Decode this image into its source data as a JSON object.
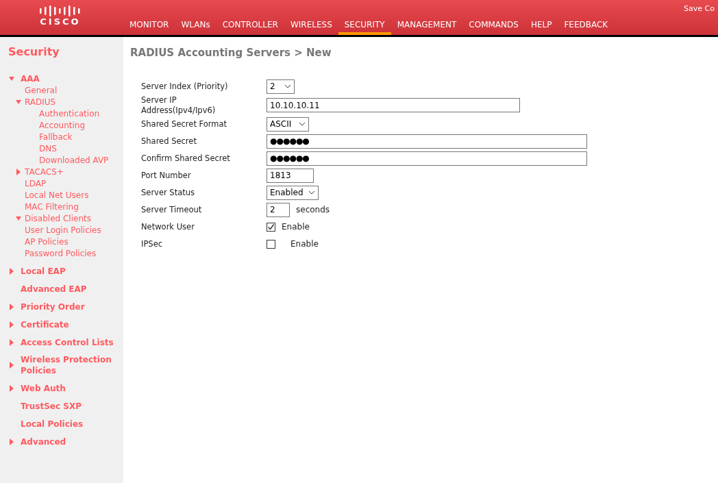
{
  "header": {
    "logo": "CISCO",
    "save_link": "Save Co",
    "nav": [
      {
        "label": "MONITOR",
        "selected": false
      },
      {
        "label": "WLANs",
        "selected": false
      },
      {
        "label": "CONTROLLER",
        "selected": false
      },
      {
        "label": "WIRELESS",
        "selected": false
      },
      {
        "label": "SECURITY",
        "selected": true
      },
      {
        "label": "MANAGEMENT",
        "selected": false
      },
      {
        "label": "COMMANDS",
        "selected": false
      },
      {
        "label": "HELP",
        "selected": false
      },
      {
        "label": "FEEDBACK",
        "selected": false
      }
    ]
  },
  "sidebar": {
    "title": "Security",
    "items": [
      {
        "label": "AAA",
        "kind": "folder",
        "expanded": true,
        "children": [
          {
            "label": "General",
            "kind": "leaf"
          },
          {
            "label": "RADIUS",
            "kind": "folder",
            "expanded": true,
            "children": [
              {
                "label": "Authentication",
                "kind": "leaf"
              },
              {
                "label": "Accounting",
                "kind": "leaf"
              },
              {
                "label": "Fallback",
                "kind": "leaf"
              },
              {
                "label": "DNS",
                "kind": "leaf"
              },
              {
                "label": "Downloaded AVP",
                "kind": "leaf"
              }
            ]
          },
          {
            "label": "TACACS+",
            "kind": "folder",
            "expanded": false
          },
          {
            "label": "LDAP",
            "kind": "leaf"
          },
          {
            "label": "Local Net Users",
            "kind": "leaf"
          },
          {
            "label": "MAC Filtering",
            "kind": "leaf"
          },
          {
            "label": "Disabled Clients",
            "kind": "folder",
            "expanded": true
          },
          {
            "label": "User Login Policies",
            "kind": "leaf"
          },
          {
            "label": "AP Policies",
            "kind": "leaf"
          },
          {
            "label": "Password Policies",
            "kind": "leaf"
          }
        ]
      },
      {
        "label": "Local EAP",
        "kind": "folder",
        "expanded": false
      },
      {
        "label": "Advanced EAP",
        "kind": "leaf"
      },
      {
        "label": "Priority Order",
        "kind": "folder",
        "expanded": false
      },
      {
        "label": "Certificate",
        "kind": "folder",
        "expanded": false
      },
      {
        "label": "Access Control Lists",
        "kind": "folder",
        "expanded": false
      },
      {
        "label": "Wireless Protection Policies",
        "kind": "folder",
        "expanded": false
      },
      {
        "label": "Web Auth",
        "kind": "folder",
        "expanded": false
      },
      {
        "label": "TrustSec SXP",
        "kind": "leaf"
      },
      {
        "label": "Local Policies",
        "kind": "leaf"
      },
      {
        "label": "Advanced",
        "kind": "folder",
        "expanded": false
      }
    ]
  },
  "page": {
    "title": "RADIUS Accounting Servers > New",
    "fields": [
      {
        "label": "Server Index (Priority)",
        "kind": "select",
        "value": "2"
      },
      {
        "label": "Server IP Address(Ipv4/Ipv6)",
        "kind": "text",
        "value": "10.10.10.11"
      },
      {
        "label": "Shared Secret Format",
        "kind": "select",
        "value": "ASCII"
      },
      {
        "label": "Shared Secret",
        "kind": "password",
        "value": "●●●●●●"
      },
      {
        "label": "Confirm Shared Secret",
        "kind": "password",
        "value": "●●●●●●"
      },
      {
        "label": "Port Number",
        "kind": "text",
        "value": "1813"
      },
      {
        "label": "Server Status",
        "kind": "select",
        "value": "Enabled"
      },
      {
        "label": "Server Timeout",
        "kind": "text",
        "value": "2",
        "suffix": "seconds"
      },
      {
        "label": "Network User",
        "kind": "checkbox",
        "checked": true,
        "text": "Enable"
      },
      {
        "label": "IPSec",
        "kind": "checkbox",
        "checked": false,
        "text": "Enable"
      }
    ]
  }
}
